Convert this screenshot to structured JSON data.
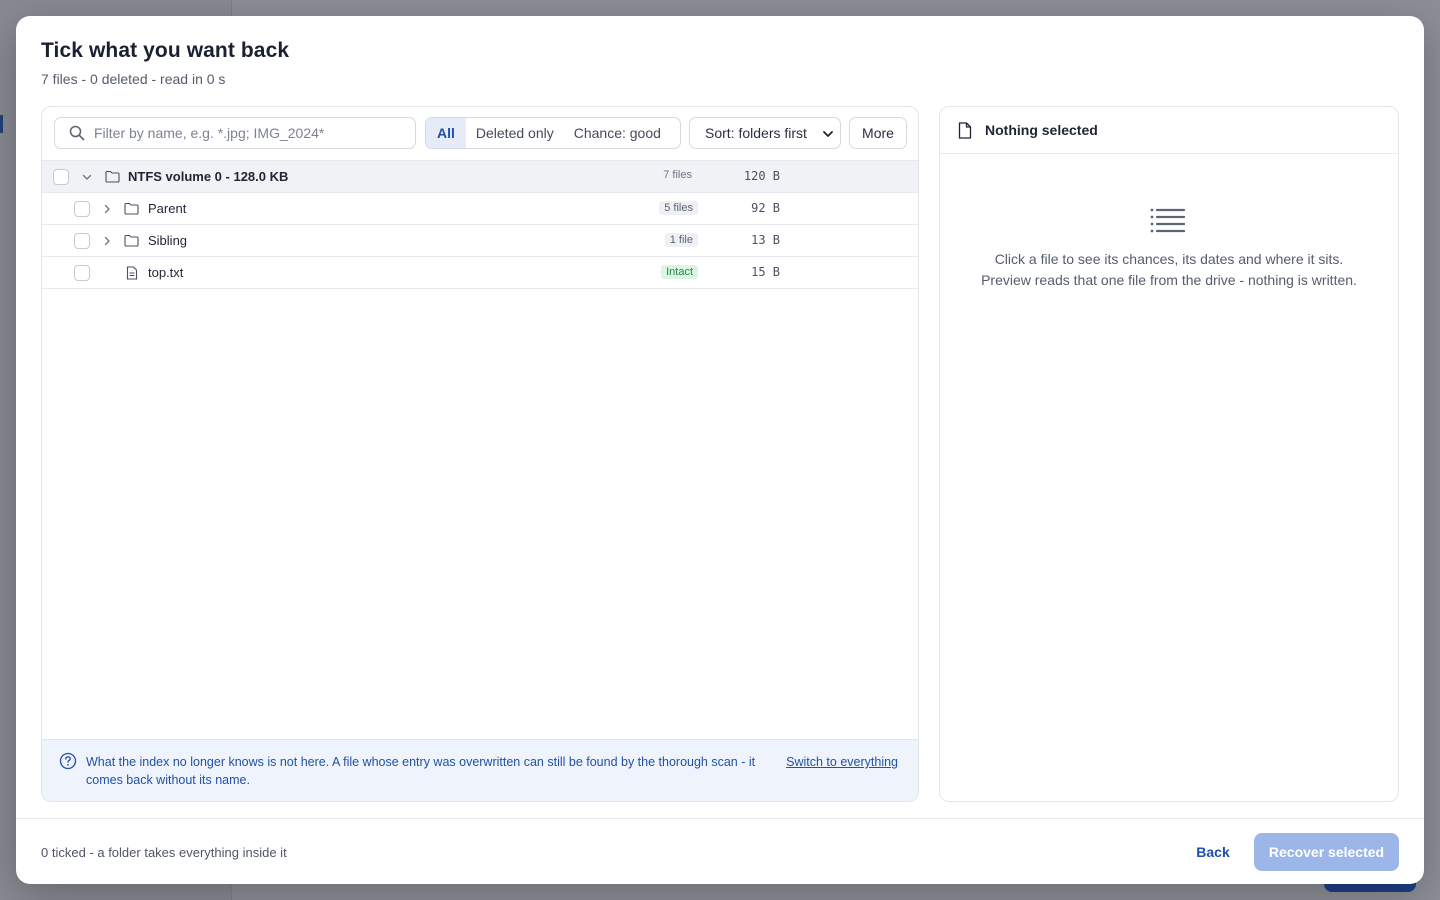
{
  "dialog": {
    "title": "Tick what you want back",
    "subtitle": "7 files - 0 deleted - read in 0 s"
  },
  "toolbar": {
    "search_placeholder": "Filter by name, e.g. *.jpg; IMG_2024*",
    "filters": [
      {
        "label": "All",
        "active": true
      },
      {
        "label": "Deleted only",
        "active": false
      },
      {
        "label": "Chance: good",
        "active": false
      }
    ],
    "sort_label": "Sort: folders first",
    "more_label": "More"
  },
  "tree": {
    "root": {
      "name": "NTFS volume 0 - 128.0 KB",
      "count": "7 files",
      "size": "120 B"
    },
    "children": [
      {
        "name": "Parent",
        "type": "folder",
        "badge": "5 files",
        "size": "92 B"
      },
      {
        "name": "Sibling",
        "type": "folder",
        "badge": "1 file",
        "size": "13 B"
      },
      {
        "name": "top.txt",
        "type": "file",
        "badge": "Intact",
        "size": "15 B"
      }
    ]
  },
  "info": {
    "text": "What the index no longer knows is not here. A file whose entry was overwritten can still be found by the thorough scan - it comes back without its name.",
    "link": "Switch to everything"
  },
  "details": {
    "title": "Nothing selected",
    "empty_text": "Click a file to see its chances, its dates and where it sits. Preview reads that one file from the drive - nothing is written."
  },
  "footer": {
    "status": "0 ticked - a folder takes everything inside it",
    "back_label": "Back",
    "recover_label": "Recover selected"
  },
  "colors": {
    "accent": "#1f4fa8",
    "intact_badge": "#1f8a46",
    "recover_disabled": "#9cb6e9",
    "info_bg": "#eef3fc"
  }
}
